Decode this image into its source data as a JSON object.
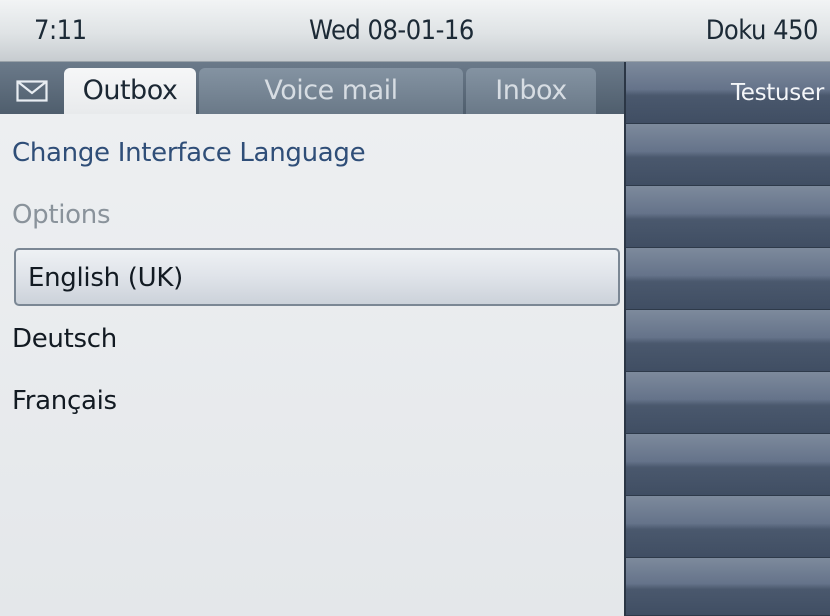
{
  "status": {
    "time": "7:11",
    "date": "Wed 08-01-16",
    "device": "Doku 450"
  },
  "tabs": [
    {
      "label": "Outbox",
      "active": true
    },
    {
      "label": "Voice mail",
      "active": false
    },
    {
      "label": "Inbox",
      "active": false
    }
  ],
  "menu": {
    "title": "Change Interface Language",
    "section": "Options",
    "options": [
      "English (UK)",
      "Deutsch",
      "Français"
    ],
    "selected_index": 0
  },
  "function_keys": {
    "key1": "Testuser",
    "key2": "",
    "key3": "",
    "key4": "",
    "key5": "",
    "key6": "",
    "key7": "",
    "key8": "",
    "key9": ""
  },
  "icons": {
    "mail": "envelope-icon"
  },
  "colors": {
    "title_text": "#2f4e78",
    "section_text": "#8a939b",
    "fkey_panel": "#3f4d61"
  }
}
